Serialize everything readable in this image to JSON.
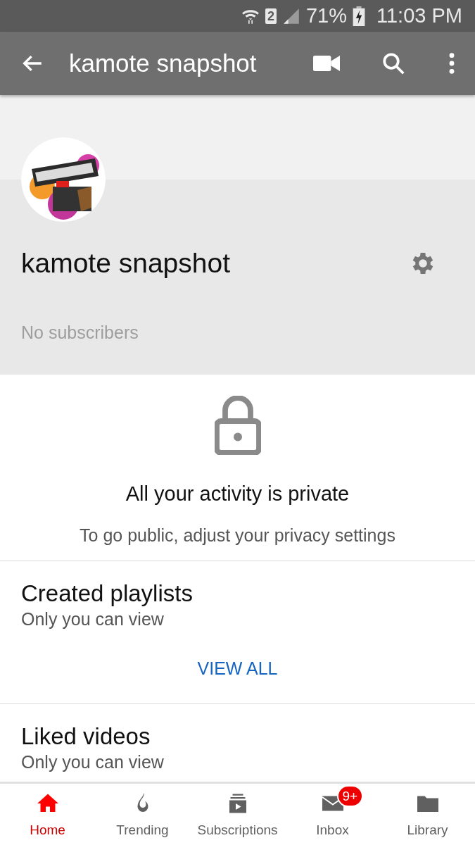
{
  "status_bar": {
    "sim": "2",
    "battery": "71%",
    "time": "11:03 PM"
  },
  "app_bar": {
    "title": "kamote snapshot"
  },
  "channel": {
    "name": "kamote snapshot",
    "subscribers": "No subscribers"
  },
  "privacy": {
    "title": "All your activity is private",
    "subtitle": "To go public, adjust your privacy settings"
  },
  "sections": [
    {
      "title": "Created playlists",
      "subtitle": "Only you can view",
      "action": "VIEW ALL"
    },
    {
      "title": "Liked videos",
      "subtitle": "Only you can view"
    }
  ],
  "bottom_nav": [
    {
      "kind": "home",
      "label": "Home",
      "selected": true
    },
    {
      "kind": "trending",
      "label": "Trending",
      "selected": false
    },
    {
      "kind": "subscriptions",
      "label": "Subscriptions",
      "selected": false
    },
    {
      "kind": "inbox",
      "label": "Inbox",
      "selected": false,
      "badge": "9+"
    },
    {
      "kind": "library",
      "label": "Library",
      "selected": false
    }
  ]
}
